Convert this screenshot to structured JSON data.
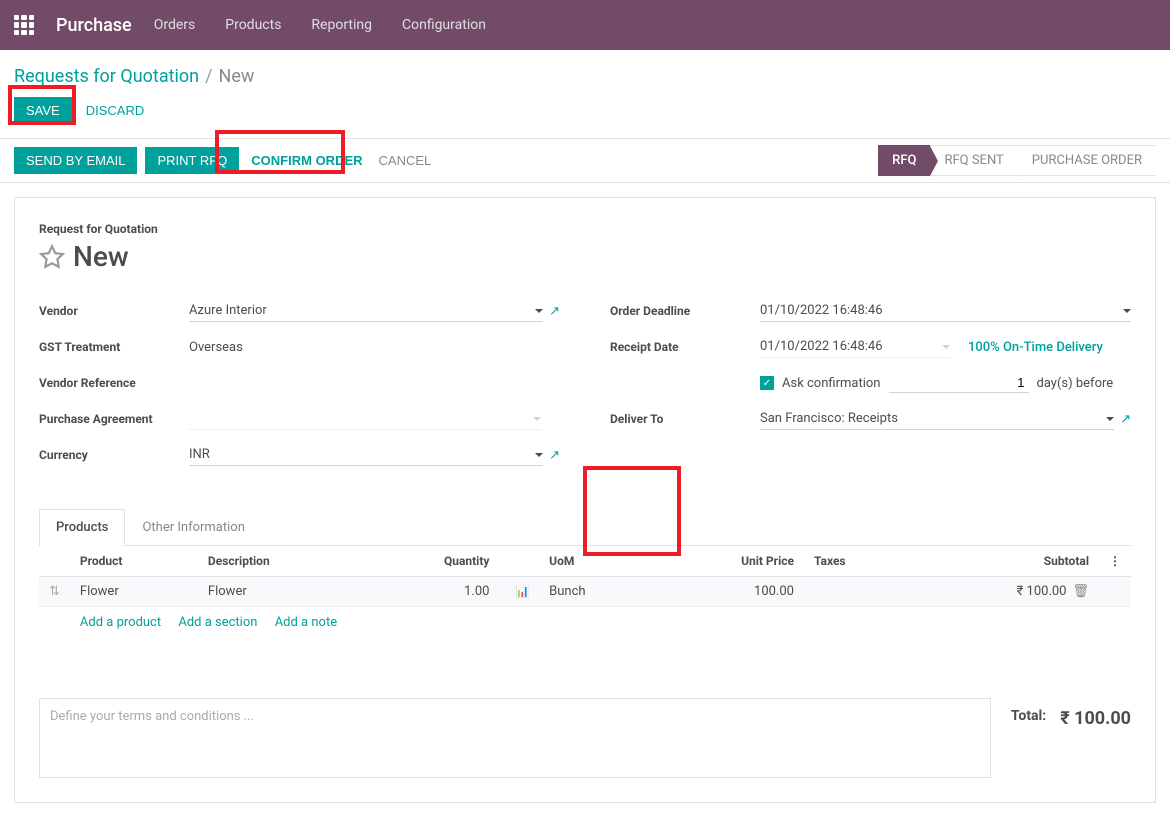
{
  "topbar": {
    "app_title": "Purchase",
    "menu": [
      "Orders",
      "Products",
      "Reporting",
      "Configuration"
    ]
  },
  "breadcrumb": {
    "link": "Requests for Quotation",
    "current": "New"
  },
  "toolbar": {
    "save": "SAVE",
    "discard": "DISCARD"
  },
  "actions": {
    "send_email": "SEND BY EMAIL",
    "print_rfq": "PRINT RFQ",
    "confirm_order": "CONFIRM ORDER",
    "cancel": "CANCEL"
  },
  "status": {
    "rfq": "RFQ",
    "rfq_sent": "RFQ SENT",
    "po": "PURCHASE ORDER"
  },
  "form": {
    "title_label": "Request for Quotation",
    "title": "New",
    "labels": {
      "vendor": "Vendor",
      "gst": "GST Treatment",
      "vendor_ref": "Vendor Reference",
      "agreement": "Purchase Agreement",
      "currency": "Currency",
      "order_deadline": "Order Deadline",
      "receipt_date": "Receipt Date",
      "deliver_to": "Deliver To"
    },
    "values": {
      "vendor": "Azure Interior",
      "gst": "Overseas",
      "currency": "INR",
      "order_deadline": "01/10/2022 16:48:46",
      "receipt_date": "01/10/2022 16:48:46",
      "on_time": "100% On-Time Delivery",
      "ask_conf": "Ask confirmation",
      "days_val": "1",
      "days_suffix": "day(s) before",
      "deliver_to": "San Francisco: Receipts"
    }
  },
  "tabs": {
    "products": "Products",
    "other": "Other Information"
  },
  "table": {
    "headers": {
      "product": "Product",
      "description": "Description",
      "quantity": "Quantity",
      "uom": "UoM",
      "unit_price": "Unit Price",
      "taxes": "Taxes",
      "subtotal": "Subtotal"
    },
    "row": {
      "product": "Flower",
      "description": "Flower",
      "quantity": "1.00",
      "uom": "Bunch",
      "unit_price": "100.00",
      "subtotal": "₹ 100.00"
    },
    "add": {
      "product": "Add a product",
      "section": "Add a section",
      "note": "Add a note"
    }
  },
  "terms_placeholder": "Define your terms and conditions ...",
  "total": {
    "label": "Total:",
    "value": "₹ 100.00"
  }
}
